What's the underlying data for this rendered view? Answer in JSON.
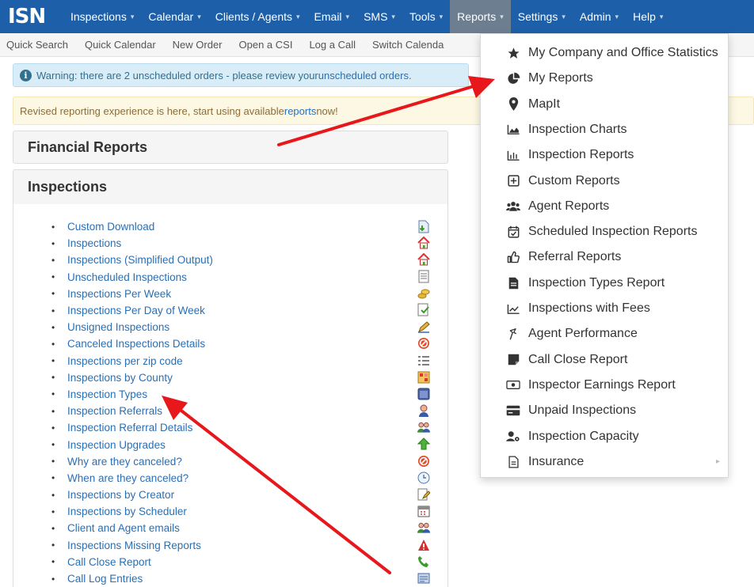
{
  "brand": {
    "logo_text": "ISN"
  },
  "navbar": {
    "items": [
      {
        "label": "Inspections",
        "caret": "▾"
      },
      {
        "label": "Calendar",
        "caret": "▾"
      },
      {
        "label": "Clients / Agents",
        "caret": "▾"
      },
      {
        "label": "Email",
        "caret": "▾"
      },
      {
        "label": "SMS",
        "caret": "▾"
      },
      {
        "label": "Tools",
        "caret": "▾"
      },
      {
        "label": "Reports",
        "caret": "▾"
      },
      {
        "label": "Settings",
        "caret": "▾"
      },
      {
        "label": "Admin",
        "caret": "▾"
      },
      {
        "label": "Help",
        "caret": "▾"
      }
    ],
    "active": "Reports"
  },
  "toolbar": {
    "items": [
      "Quick Search",
      "Quick Calendar",
      "New Order",
      "Open a CSI",
      "Log a Call",
      "Switch Calenda"
    ]
  },
  "alerts": {
    "info_prefix": "Warning: there are 2 unscheduled orders - please review your ",
    "info_link": "unscheduled orders.",
    "warn_prefix": "Revised reporting experience is here, start using available ",
    "warn_link": "reports",
    "warn_suffix": " now!"
  },
  "panels": {
    "financial_title": "Financial Reports",
    "inspections_title": "Inspections"
  },
  "inspection_reports": [
    {
      "label": "Custom Download",
      "icon": "download-doc-icon"
    },
    {
      "label": "Inspections",
      "icon": "house-icon"
    },
    {
      "label": "Inspections (Simplified Output)",
      "icon": "house-icon"
    },
    {
      "label": "Unscheduled Inspections",
      "icon": "list-doc-icon"
    },
    {
      "label": "Inspections Per Week",
      "icon": "coins-icon"
    },
    {
      "label": "Inspections Per Day of Week",
      "icon": "check-doc-icon"
    },
    {
      "label": "Unsigned Inspections",
      "icon": "pen-icon"
    },
    {
      "label": "Canceled Inspections Details",
      "icon": "no-entry-icon"
    },
    {
      "label": "Inspections per zip code",
      "icon": "numbered-list-icon"
    },
    {
      "label": "Inspections by County",
      "icon": "map-grid-icon"
    },
    {
      "label": "Inspection Types",
      "icon": "window-icon"
    },
    {
      "label": "Inspection Referrals",
      "icon": "person-icon"
    },
    {
      "label": "Inspection Referral Details",
      "icon": "people-icon"
    },
    {
      "label": "Inspection Upgrades",
      "icon": "up-arrow-icon"
    },
    {
      "label": "Why are they canceled?",
      "icon": "no-entry-icon"
    },
    {
      "label": "When are they canceled?",
      "icon": "clock-icon"
    },
    {
      "label": "Inspections by Creator",
      "icon": "edit-doc-icon"
    },
    {
      "label": "Inspections by Scheduler",
      "icon": "calendar-icon"
    },
    {
      "label": "Client and Agent emails",
      "icon": "people-icon"
    },
    {
      "label": "Inspections Missing Reports",
      "icon": "warning-icon"
    },
    {
      "label": "Call Close Report",
      "icon": "phone-icon"
    },
    {
      "label": "Call Log Entries",
      "icon": "log-icon"
    }
  ],
  "reports_menu": [
    {
      "label": "My Company and Office Statistics",
      "icon": "star-icon"
    },
    {
      "label": "My Reports",
      "icon": "pie-chart-icon"
    },
    {
      "label": "MapIt",
      "icon": "map-marker-icon"
    },
    {
      "label": "Inspection Charts",
      "icon": "area-chart-icon"
    },
    {
      "label": "Inspection Reports",
      "icon": "bar-chart-icon"
    },
    {
      "label": "Custom Reports",
      "icon": "plus-square-icon"
    },
    {
      "label": "Agent Reports",
      "icon": "users-icon"
    },
    {
      "label": "Scheduled Inspection Reports",
      "icon": "calendar-check-icon"
    },
    {
      "label": "Referral Reports",
      "icon": "thumbs-up-icon"
    },
    {
      "label": "Inspection Types Report",
      "icon": "file-icon"
    },
    {
      "label": "Inspections with Fees",
      "icon": "line-chart-icon"
    },
    {
      "label": "Agent Performance",
      "icon": "performance-icon"
    },
    {
      "label": "Call Close Report",
      "icon": "sticky-note-icon"
    },
    {
      "label": "Inspector Earnings Report",
      "icon": "money-icon"
    },
    {
      "label": "Unpaid Inspections",
      "icon": "credit-card-icon"
    },
    {
      "label": "Inspection Capacity",
      "icon": "user-cog-icon"
    },
    {
      "label": "Insurance",
      "icon": "file-text-icon",
      "has_submenu": true,
      "submenu_caret": "▸"
    }
  ],
  "colors": {
    "navbar": "#1d5fa8",
    "nav_active": "#6d7e91",
    "link": "#2a6fb4",
    "annotation_arrow": "#e8171b"
  }
}
